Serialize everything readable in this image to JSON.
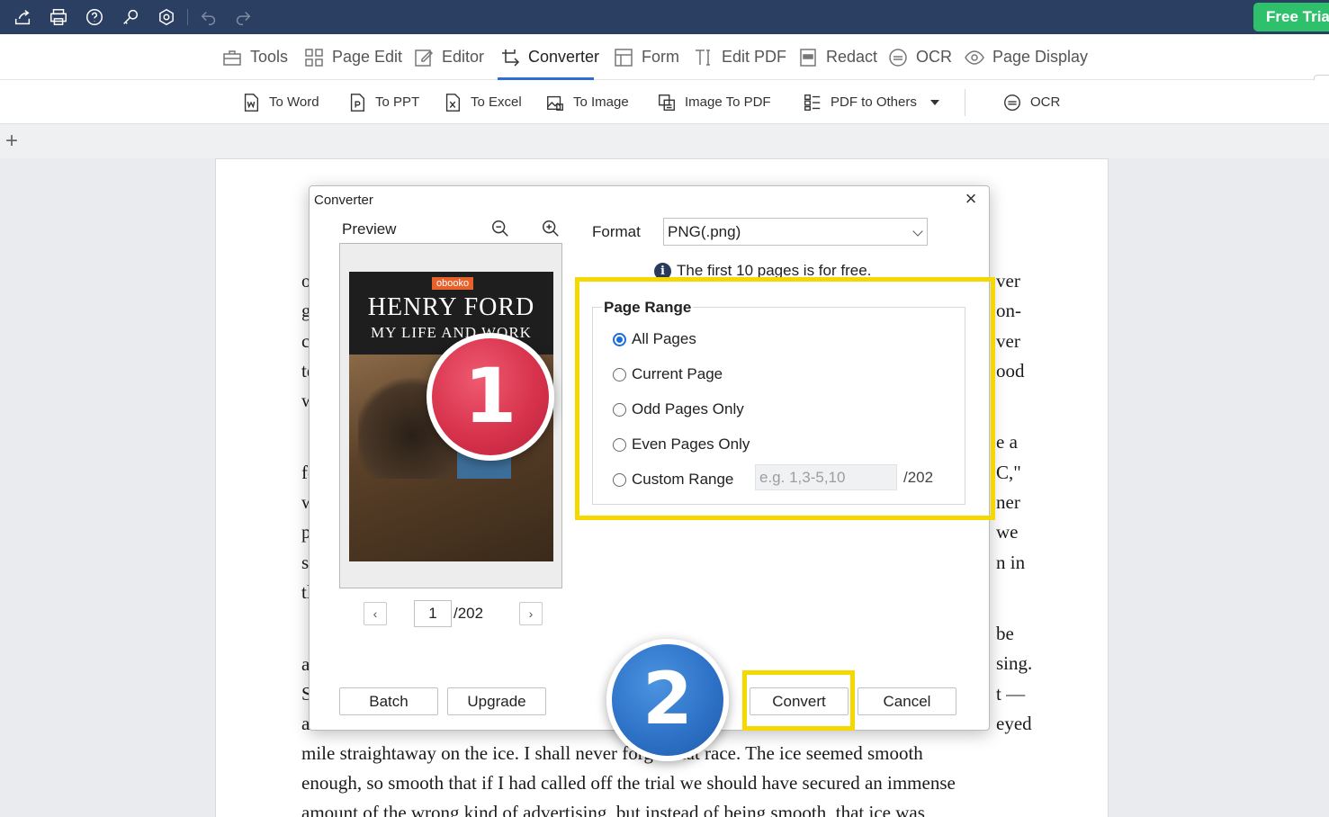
{
  "topbar": {
    "icons": [
      "share-icon",
      "print-icon",
      "help-icon",
      "key-icon",
      "settings-icon",
      "undo-icon",
      "redo-icon"
    ],
    "free_trial_label": "Free Trial"
  },
  "tabs": [
    {
      "label": "Tools",
      "icon": "toolbox-icon"
    },
    {
      "label": "Page Edit",
      "icon": "grid-icon"
    },
    {
      "label": "Editor",
      "icon": "edit-icon"
    },
    {
      "label": "Converter",
      "icon": "convert-icon",
      "active": true
    },
    {
      "label": "Form",
      "icon": "form-icon"
    },
    {
      "label": "Edit PDF",
      "icon": "text-cursor-icon"
    },
    {
      "label": "Redact",
      "icon": "redact-icon"
    },
    {
      "label": "OCR",
      "icon": "ocr-icon"
    },
    {
      "label": "Page Display",
      "icon": "eye-icon"
    }
  ],
  "subtoolbar": [
    {
      "label": "To Word",
      "icon": "word-icon"
    },
    {
      "label": "To PPT",
      "icon": "ppt-icon"
    },
    {
      "label": "To Excel",
      "icon": "excel-icon"
    },
    {
      "label": "To Image",
      "icon": "image-icon"
    },
    {
      "label": "Image To PDF",
      "icon": "image-to-pdf-icon"
    },
    {
      "label": "PDF to Others",
      "icon": "list-icon"
    },
    {
      "label": "OCR",
      "icon": "ocr-icon"
    }
  ],
  "document": {
    "lines": [
      "mile straightaway on the ice. I shall never forget that race. The ice seemed smooth",
      "enough, so smooth that if I had called off the trial we should have secured an immense",
      "amount of the wrong kind of advertising, but instead of being smooth, that ice was"
    ],
    "left_fragments": [
      "o",
      "g",
      "c",
      "te",
      "w",
      "fe",
      "w",
      "p",
      "s",
      "tl",
      "a",
      "S",
      "a"
    ],
    "right_fragments": [
      "ver",
      "on-",
      "ver",
      "ood",
      "e a",
      "C,\"",
      "ner",
      "we",
      "n in",
      "be",
      "sing.",
      "t —",
      "eyed"
    ]
  },
  "dialog": {
    "title": "Converter",
    "preview_label": "Preview",
    "cover": {
      "badge": "obooko",
      "title": "HENRY FORD",
      "subtitle": "MY LIFE AND WORK"
    },
    "page_current": "1",
    "page_total": "/202",
    "format_label": "Format",
    "format_value": "PNG(.png)",
    "free_note": "The first 10 pages is for free.",
    "page_range": {
      "legend": "Page Range",
      "options": [
        "All Pages",
        "Current Page",
        "Odd Pages Only",
        "Even Pages Only",
        "Custom Range"
      ],
      "selected": "All Pages",
      "custom_placeholder": "e.g. 1,3-5,10",
      "custom_total": "/202"
    },
    "buttons": {
      "batch": "Batch",
      "upgrade": "Upgrade",
      "convert": "Convert",
      "cancel": "Cancel"
    }
  },
  "annotations": {
    "step1": "1",
    "step2": "2",
    "highlight_color": "#f5d800"
  }
}
